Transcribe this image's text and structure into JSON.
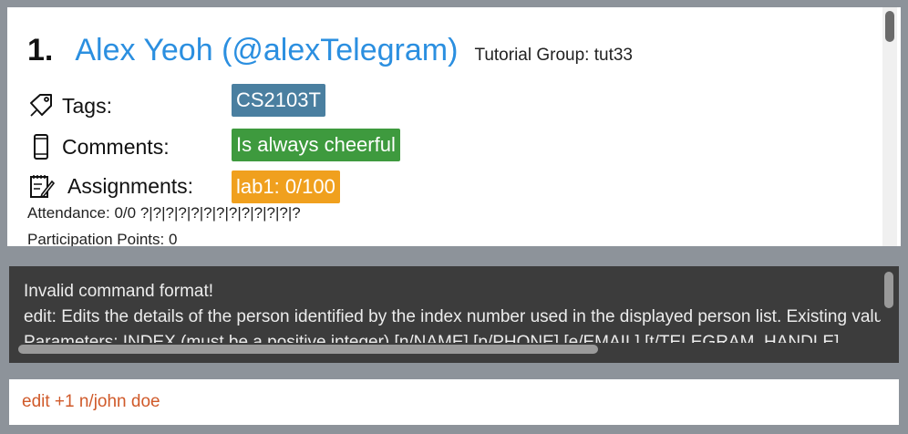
{
  "person": {
    "index": "1.",
    "name": "Alex Yeoh (@alexTelegram)",
    "tutorial_group": "Tutorial Group: tut33",
    "tags": {
      "label": "Tags:",
      "icon": "tag-icon",
      "values": [
        "CS2103T"
      ],
      "color": "#4a7fa0"
    },
    "comments": {
      "label": "Comments:",
      "icon": "phone-icon",
      "values": [
        "Is always cheerful"
      ],
      "color": "#3e9a3e"
    },
    "assignments": {
      "label": "Assignments:",
      "icon": "notepad-icon",
      "values": [
        "lab1: 0/100"
      ],
      "color": "#f0a01e"
    },
    "attendance": "Attendance: 0/0  ?|?|?|?|?|?|?|?|?|?|?|?|?",
    "participation": "Participation Points: 0"
  },
  "result": {
    "line1": "Invalid command format!",
    "line2": "edit: Edits the details of the person identified by the index number used in the displayed person list. Existing values will be overwritten by the input values.",
    "line3": "Parameters: INDEX (must be a positive integer) [n/NAME] [p/PHONE] [e/EMAIL] [t/TELEGRAM_HANDLE]"
  },
  "command": {
    "value": "edit +1 n/john doe"
  }
}
